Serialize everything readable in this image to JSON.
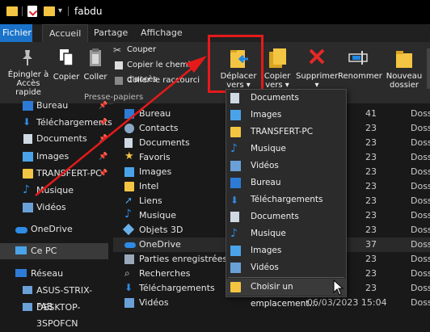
{
  "window": {
    "title": "fabdu"
  },
  "tabs": {
    "file": "Fichier",
    "home": "Accueil",
    "share": "Partage",
    "view": "Affichage"
  },
  "ribbon": {
    "pin_label": "Épingler à Accès rapide",
    "copy_label": "Copier",
    "paste_label": "Coller",
    "cut_label": "Couper",
    "copy_path_label": "Copier le chemin d'accès",
    "paste_shortcut_label": "Coller le raccourci",
    "group_label": "Presse-papiers",
    "move_to_label_1": "Déplacer",
    "move_to_label_2": "vers",
    "copy_to_label_1": "Copier",
    "copy_to_label_2": "vers",
    "delete_label": "Supprimer",
    "rename_label": "Renommer",
    "new_folder_label_1": "Nouveau",
    "new_folder_label_2": "dossier"
  },
  "nav": {
    "items": [
      {
        "label": "Bureau",
        "icon": "desktop-icon",
        "pinned": true
      },
      {
        "label": "Téléchargements",
        "icon": "download-icon",
        "pinned": true
      },
      {
        "label": "Documents",
        "icon": "documents-icon",
        "pinned": true
      },
      {
        "label": "Images",
        "icon": "pictures-icon",
        "pinned": true
      },
      {
        "label": "TRANSFERT-PC",
        "icon": "folder-icon",
        "pinned": true
      },
      {
        "label": "Musique",
        "icon": "music-icon",
        "pinned": false
      },
      {
        "label": "Vidéos",
        "icon": "videos-icon",
        "pinned": false
      },
      {
        "label": "OneDrive",
        "icon": "onedrive-icon",
        "pinned": false
      },
      {
        "label": "Ce PC",
        "icon": "pc-icon",
        "pinned": false
      },
      {
        "label": "Réseau",
        "icon": "network-icon",
        "pinned": false
      },
      {
        "label": "ASUS-STRIX-FAB",
        "icon": "computer-icon",
        "pinned": false
      },
      {
        "label": "DESKTOP-3SPOFCN",
        "icon": "computer-icon",
        "pinned": false
      }
    ]
  },
  "list": {
    "rows": [
      {
        "name": "Bureau",
        "date": "",
        "type": "",
        "icon": "desktop-icon"
      },
      {
        "name": "Contacts",
        "date": "",
        "type": "",
        "icon": "contacts-icon"
      },
      {
        "name": "Documents",
        "date": "",
        "type": "",
        "icon": "documents-icon"
      },
      {
        "name": "Favoris",
        "date": "",
        "type": "",
        "icon": "star-icon"
      },
      {
        "name": "Images",
        "date": "",
        "type": "",
        "icon": "pictures-icon"
      },
      {
        "name": "Intel",
        "date": "",
        "type": "",
        "icon": "folder-icon"
      },
      {
        "name": "Liens",
        "date": "",
        "type": "",
        "icon": "link-icon"
      },
      {
        "name": "Musique",
        "date": "",
        "type": "",
        "icon": "music-icon"
      },
      {
        "name": "Objets 3D",
        "date": "",
        "type": "",
        "icon": "cube-icon"
      },
      {
        "name": "OneDrive",
        "date": "",
        "type": "",
        "icon": "onedrive-icon"
      },
      {
        "name": "Parties enregistrées",
        "date": "",
        "type": "",
        "icon": "games-icon"
      },
      {
        "name": "Recherches",
        "date": "",
        "type": "",
        "icon": "search-icon"
      },
      {
        "name": "Téléchargements",
        "date": "",
        "type": "",
        "icon": "download-icon"
      },
      {
        "name": "Vidéos",
        "date": "06/03/2023 15:04",
        "type": "Dossi",
        "icon": "videos-icon"
      }
    ],
    "clipped_times": [
      "41",
      "23",
      "23",
      "23",
      "23",
      "23",
      "23",
      "23",
      "23",
      "37",
      "23",
      "23",
      "23"
    ],
    "clipped_types": [
      "Dossie",
      "Dossie",
      "Dossie",
      "Dossie",
      "Dossie",
      "Dossie",
      "Dossie",
      "Dossie",
      "Dossie",
      "Dossie",
      "Dossie",
      "Dossie",
      "Dossie"
    ]
  },
  "dropdown": {
    "items": [
      {
        "label": "Documents",
        "icon": "documents-icon"
      },
      {
        "label": "Images",
        "icon": "pictures-icon"
      },
      {
        "label": "TRANSFERT-PC",
        "icon": "folder-icon"
      },
      {
        "label": "Musique",
        "icon": "music-icon"
      },
      {
        "label": "Vidéos",
        "icon": "videos-icon"
      },
      {
        "label": "Bureau",
        "icon": "desktop-icon"
      },
      {
        "label": "Téléchargements",
        "icon": "download-icon"
      },
      {
        "label": "Documents",
        "icon": "documents-icon"
      },
      {
        "label": "Musique",
        "icon": "music-icon"
      },
      {
        "label": "Images",
        "icon": "pictures-icon"
      },
      {
        "label": "Vidéos",
        "icon": "videos-icon"
      }
    ],
    "choose_label": "Choisir un emplacement..."
  },
  "colors": {
    "accent": "#1a73c9",
    "highlight": "#e51a1a",
    "folder": "#f4c542"
  }
}
